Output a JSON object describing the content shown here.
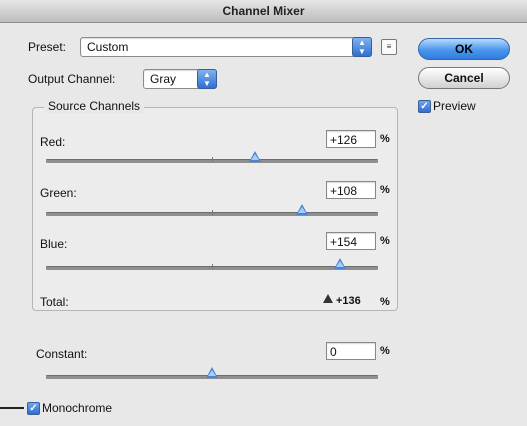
{
  "window": {
    "title": "Channel Mixer"
  },
  "preset": {
    "label": "Preset:",
    "value": "Custom",
    "icon": "preset-options-icon"
  },
  "output_channel": {
    "label": "Output Channel:",
    "value": "Gray"
  },
  "buttons": {
    "ok": "OK",
    "cancel": "Cancel"
  },
  "preview": {
    "label": "Preview",
    "checked": true
  },
  "source_channels": {
    "title": "Source Channels",
    "channels": [
      {
        "label": "Red:",
        "value": "+126",
        "unit": "%",
        "percent": 126
      },
      {
        "label": "Green:",
        "value": "+108",
        "unit": "%",
        "percent": 108
      },
      {
        "label": "Blue:",
        "value": "+154",
        "unit": "%",
        "percent": 154
      }
    ],
    "total": {
      "label": "Total:",
      "value": "+136",
      "unit": "%",
      "warning_icon": "warning-triangle-icon"
    }
  },
  "constant": {
    "label": "Constant:",
    "value": "0",
    "unit": "%",
    "percent": 0
  },
  "monochrome": {
    "label": "Monochrome",
    "checked": true
  },
  "slider_range": {
    "min": -200,
    "max": 200
  },
  "colors": {
    "accent": "#2f6fd2",
    "thumb": "#4a84d8"
  }
}
